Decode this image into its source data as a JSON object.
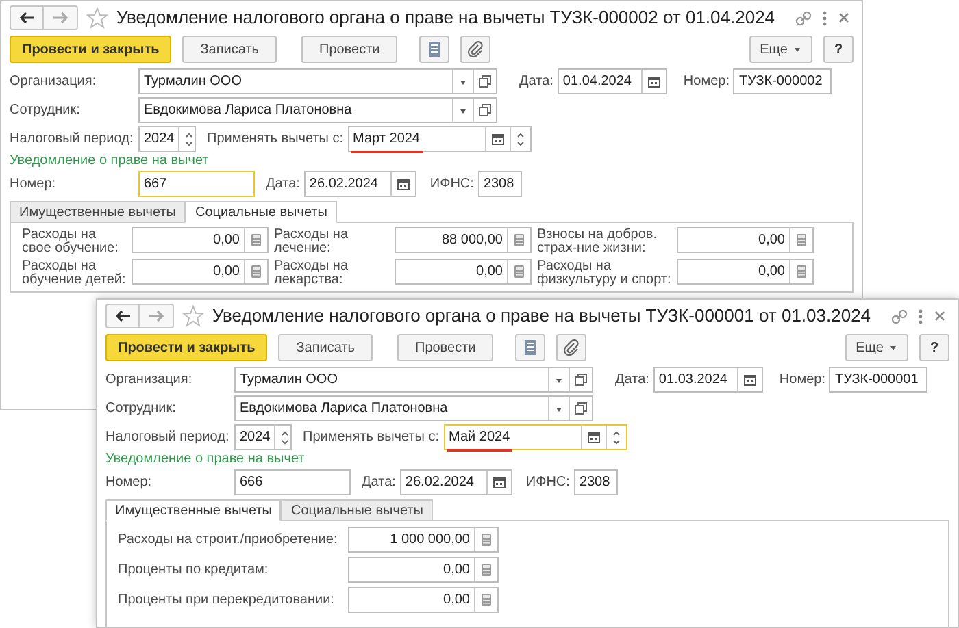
{
  "windows": [
    {
      "title": "Уведомление налогового органа о праве на вычеты ТУЗК-000002 от 01.04.2024",
      "toolbar": [
        {
          "label": "Провести и закрыть",
          "kind": "primary"
        },
        {
          "label": "Записать",
          "kind": "plain"
        },
        {
          "label": "Провести",
          "kind": "plain"
        }
      ],
      "more": "Еще",
      "help": "?",
      "organization": {
        "label": "Организация:",
        "value": "Турмалин ООО"
      },
      "date": {
        "label": "Дата:",
        "value": "01.04.2024"
      },
      "number": {
        "label": "Номер:",
        "value": "ТУЗК-000002"
      },
      "employee": {
        "label": "Сотрудник:",
        "value": "Евдокимова Лариса Платоновна"
      },
      "tax_period": {
        "label": "Налоговый период:",
        "value": "2024"
      },
      "apply_from": {
        "label": "Применять вычеты с:",
        "value": "Март 2024",
        "focused": false,
        "underlined": true
      },
      "notice": {
        "heading": "Уведомление о праве на вычет",
        "number": {
          "label": "Номер:",
          "value": "667",
          "focused": true
        },
        "date": {
          "label": "Дата:",
          "value": "26.02.2024"
        },
        "ifns": {
          "label": "ИФНС:",
          "value": "2308"
        }
      },
      "tabs": [
        {
          "label": "Имущественные вычеты",
          "selected": false
        },
        {
          "label": "Социальные вычеты",
          "selected": true
        }
      ],
      "deductions": [
        {
          "label": "Расходы на свое обучение:",
          "value": "0,00"
        },
        {
          "label": "Расходы на лечение:",
          "value": "88 000,00"
        },
        {
          "label": "Взносы на добров. страх-ние жизни:",
          "value": "0,00"
        },
        {
          "label": "Расходы на обучение детей:",
          "value": "0,00"
        },
        {
          "label": "Расходы на лекарства:",
          "value": "0,00"
        },
        {
          "label": "Расходы на физкультуру и спорт:",
          "value": "0,00"
        }
      ]
    },
    {
      "title": "Уведомление налогового органа о праве на вычеты ТУЗК-000001 от 01.03.2024",
      "toolbar": [
        {
          "label": "Провести и закрыть",
          "kind": "primary"
        },
        {
          "label": "Записать",
          "kind": "plain"
        },
        {
          "label": "Провести",
          "kind": "plain"
        }
      ],
      "more": "Еще",
      "help": "?",
      "organization": {
        "label": "Организация:",
        "value": "Турмалин ООО"
      },
      "date": {
        "label": "Дата:",
        "value": "01.03.2024"
      },
      "number": {
        "label": "Номер:",
        "value": "ТУЗК-000001"
      },
      "employee": {
        "label": "Сотрудник:",
        "value": "Евдокимова Лариса Платоновна"
      },
      "tax_period": {
        "label": "Налоговый период:",
        "value": "2024"
      },
      "apply_from": {
        "label": "Применять вычеты с:",
        "value": "Май 2024",
        "focused": true,
        "underlined": true
      },
      "notice": {
        "heading": "Уведомление о праве на вычет",
        "number": {
          "label": "Номер:",
          "value": "666",
          "focused": false
        },
        "date": {
          "label": "Дата:",
          "value": "26.02.2024"
        },
        "ifns": {
          "label": "ИФНС:",
          "value": "2308"
        }
      },
      "tabs": [
        {
          "label": "Имущественные вычеты",
          "selected": true
        },
        {
          "label": "Социальные вычеты",
          "selected": false
        }
      ],
      "deductions": [
        {
          "label": "Расходы на строит./приобретение:",
          "value": "1 000 000,00"
        },
        {
          "label": "Проценты по кредитам:",
          "value": "0,00"
        },
        {
          "label": "Проценты при перекредитовании:",
          "value": "0,00"
        }
      ]
    }
  ]
}
